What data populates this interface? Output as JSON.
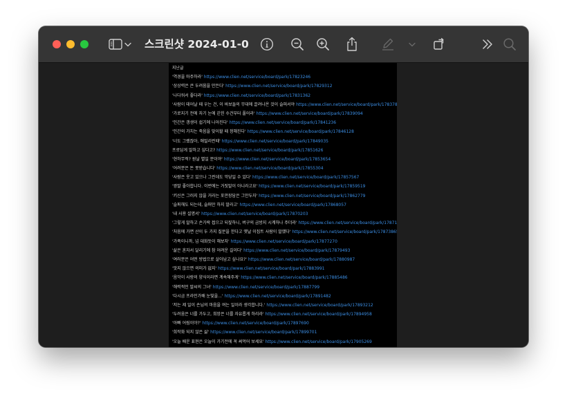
{
  "window": {
    "title": "스크린샷 2024-01-0...",
    "colors": {
      "close": "#ff5f57",
      "minimize": "#febc2e",
      "maximize": "#28c840",
      "toolbar": "#353535",
      "page": "#000000",
      "link": "#3c8fe6"
    }
  },
  "toolbar": {
    "icons": [
      "sidebar-icon",
      "chevron-down-icon",
      "info-icon",
      "zoom-out-icon",
      "zoom-in-icon",
      "share-icon",
      "markup-pen-icon",
      "chevron-down-icon",
      "rotate-icon",
      "more-chevron-icon",
      "search-icon"
    ]
  },
  "document": {
    "lines": [
      {
        "text": "지난글",
        "url": ""
      },
      {
        "text": "'역경을 마주하라' ",
        "url": "https://www.clien.net/service/board/park/17823246"
      },
      {
        "text": "'상상력은 큰 두려움을 만든다' ",
        "url": "https://www.clien.net/service/board/park/17829312"
      },
      {
        "text": "'나다워서 좋다라' ",
        "url": "https://www.clien.net/service/board/park/17831362"
      },
      {
        "text": "'사람이 태어날 때 우는 건, 이 바보들의 무대에 끌려나온 것이 슬퍼서야 ",
        "url": "https://www.clien.net/service/board/park/17837879"
      },
      {
        "text": "'가로지기 전에 자기 눈에 갇힌 수건부터 풀어라' ",
        "url": "https://www.clien.net/service/board/park/17839094"
      },
      {
        "text": "'인간은 갱생이 쉽기에 나아진다' ",
        "url": "https://www.clien.net/service/board/park/17841236"
      },
      {
        "text": "'인간의 가치는 죽음을 맞이할 때 정해진다' ",
        "url": "https://www.clien.net/service/board/park/17846128"
      },
      {
        "text": "'너도 그랬잖아, 애밀리런때' ",
        "url": "https://www.clien.net/service/board/park/17849035"
      },
      {
        "text": "프로답게 말하고 싶다고? ",
        "url": "https://www.clien.net/service/board/park/17851626"
      },
      {
        "text": "'현하무적? 원날 별일 분이야' ",
        "url": "https://www.clien.net/service/board/park/17853654"
      },
      {
        "text": "'어려분은 돈 못받습니다' ",
        "url": "https://www.clien.net/service/board/park/17855304"
      },
      {
        "text": "'사람은 웃고 있으나 그런데도 악당일 수 있다' ",
        "url": "https://www.clien.net/service/board/park/17857567"
      },
      {
        "text": "'쌍말 좋아합니다. 이번에는 거짓말이 아니라고요' ",
        "url": "https://www.clien.net/service/board/park/17859519"
      },
      {
        "text": "'키신은 그러지 않을 거라는 포만장담은 그만두자' ",
        "url": "https://www.clien.net/service/board/park/17862779"
      },
      {
        "text": "'슬퍼해도 되는데, 슬퍼만 하지 말라고' ",
        "url": "https://www.clien.net/service/board/park/17868057"
      },
      {
        "text": "'내 사용 설명서' ",
        "url": "https://www.clien.net/service/board/park/17870203"
      },
      {
        "text": "'그렇게 말하고 손가락 접으고 되짚하니, 버구의 금방지 시계하나 주더라' ",
        "url": "https://www.clien.net/service/board/park/17871374"
      },
      {
        "text": "'처음에 가면 산이 두 가지 질문을 한다고 옛날 이집트 사람이 말했다' ",
        "url": "https://www.clien.net/service/board/park/17873865"
      },
      {
        "text": "'가족이니까, 넘 대화듯이 해보자' ",
        "url": "https://www.clien.net/service/board/park/17877270"
      },
      {
        "text": "'삶은 혼자서 달리기에 참 어려운 길이다' ",
        "url": "https://www.clien.net/service/board/park/17879493"
      },
      {
        "text": "'여러분은 어떤 방법으로 살아남고 싶나요?' ",
        "url": "https://www.clien.net/service/board/park/17880987"
      },
      {
        "text": "'맛지 않으면 의미가 없지' ",
        "url": "https://www.clien.net/service/board/park/17883991"
      },
      {
        "text": "'음악이 사랑의 양식이라면 계속해주게' ",
        "url": "https://www.clien.net/service/board/park/17885486"
      },
      {
        "text": "'해력적인 말씨의 그녀' ",
        "url": "https://www.clien.net/service/board/park/17887799"
      },
      {
        "text": "'다시금 프라인가배 눈빛을...' ",
        "url": "https://www.clien.net/service/board/park/17891482"
      },
      {
        "text": "'저는 제 일이 손님의 마음을 여는 일이라 생각합니다.' ",
        "url": "https://www.clien.net/service/board/park/17893212"
      },
      {
        "text": "'두려움은 너를 가두고, 희망은 너를 자유롭게 하리라' ",
        "url": "https://www.clien.net/service/board/park/17894958"
      },
      {
        "text": "'아빠 어림이야?' ",
        "url": "https://www.clien.net/service/board/park/17897690"
      },
      {
        "text": "'희작화 되지 않은 삶' ",
        "url": "https://www.clien.net/service/board/park/17899701"
      },
      {
        "text": "'오늘 배운 표현은 오늘이 가기전에 꼭 써먹어 보세요' ",
        "url": "https://www.clien.net/service/board/park/17905269"
      }
    ]
  }
}
